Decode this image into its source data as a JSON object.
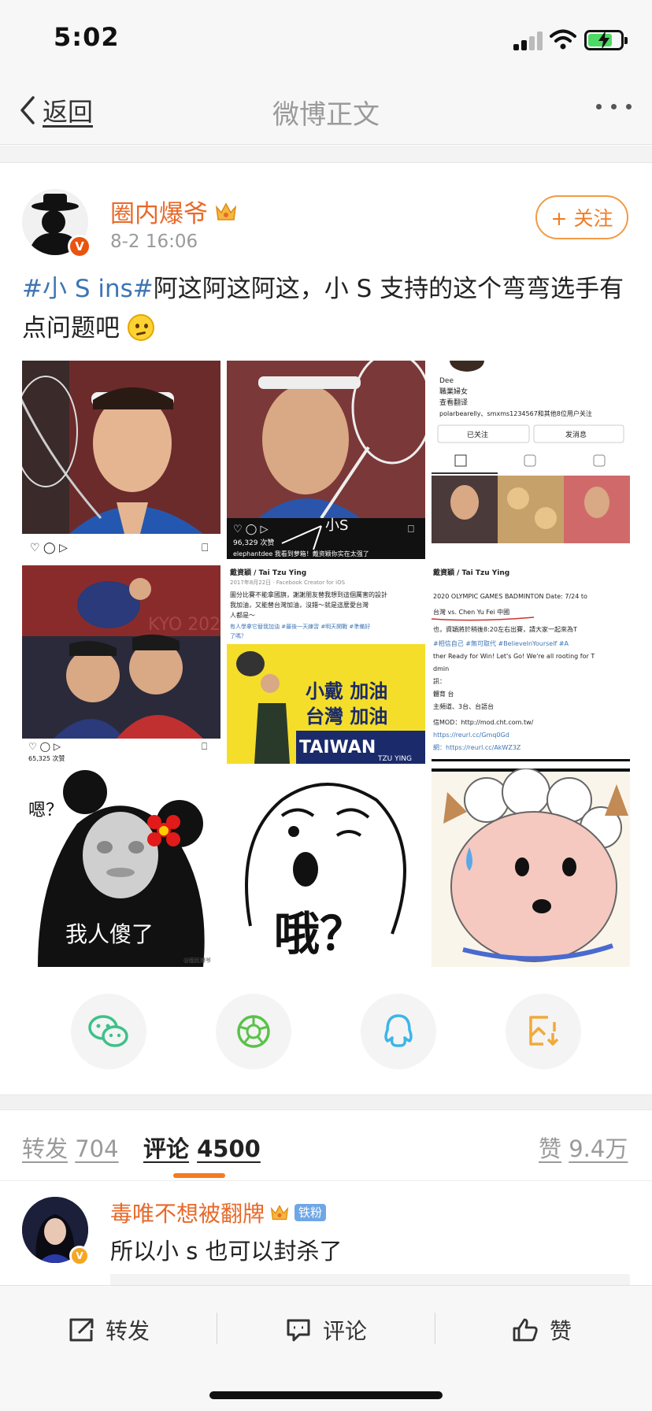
{
  "status_bar": {
    "time": "5:02"
  },
  "nav": {
    "back_label": "返回",
    "title": "微博正文"
  },
  "post": {
    "author": "圈内爆爷",
    "time": "8-2 16:06",
    "follow_label": "+ 关注",
    "hashtag": "#小 S ins#",
    "text": "阿这阿这阿这，小 S 支持的这个弯弯选手有点问题吧",
    "images": [
      {
        "caption": ""
      },
      {
        "caption": "96,329 次赞",
        "sub": "elephantdee 我看到萝箱！戴资颖你实在太强了",
        "annotation": "小S"
      },
      {
        "caption": "Dee",
        "sub1": "職業婦女",
        "sub2": "查看翻译",
        "sub3": "polarbearelly、smxms1234567和其他8位用户关注",
        "btn1": "已关注",
        "btn2": "发消息"
      },
      {
        "caption": "65,325 次赞"
      },
      {
        "caption": "戴資穎 / Tai Tzu Ying",
        "sub": "2017年8月22日 · Facebook Creator for iOS",
        "line1": "圖分比賽不能拿國旗，謝謝朋友替我想到這個厲害的設計",
        "line2": "我加油，又能替台灣加油，沒錯～就是這麼愛台灣",
        "line3": "人都是～",
        "line4": "有人學拿它替我加油 #最後一天練習 #明天開戰 #準備好",
        "line5": "了嗎？",
        "banner1": "小戴 加油",
        "banner2": "台灣 加油",
        "banner3": "TAIWAN",
        "banner4": "TZU YING"
      },
      {
        "caption": "戴資穎 / Tai Tzu Ying",
        "line1": "2020 OLYMPIC GAMES BADMINTON Date: 7/24 to",
        "line2": "台灣 vs. Chen Yu Fei 中國",
        "line3": "也，資穎將於稍後8:20左右出賽，請大家一起來為T",
        "line4": "#相信自己 #無可取代 #BelieveInYourself #A",
        "line5": "ther Ready for Win! Let's Go! We're all rooting for T",
        "line6": "dmin",
        "line7": "訊：",
        "line8": "體育 台",
        "line9": "主頻道、3台、台語台",
        "line10": "信MOD：http://mod.cht.com.tw/",
        "line11": "https://reurl.cc/Gmq0Gd",
        "line12": "網：https://reurl.cc/AkWZ3Z"
      },
      {
        "caption": "嗯？",
        "sub": "我人傻了",
        "watermark": "@國民爆爷"
      },
      {
        "caption": "哦？"
      },
      {
        "caption": ""
      }
    ]
  },
  "share": {
    "icons": [
      "wechat-icon",
      "moments-icon",
      "qq-icon",
      "save-image-icon"
    ]
  },
  "tabs": {
    "repost_label": "转发",
    "repost_count": "704",
    "comment_label": "评论",
    "comment_count": "4500",
    "like_label": "赞",
    "like_count": "9.4万"
  },
  "comment": {
    "author": "毒唯不想被翻牌",
    "badge": "铁粉",
    "text": "所以小 s 也可以封杀了"
  },
  "actions": {
    "repost": "转发",
    "comment": "评论",
    "like": "赞"
  },
  "colors": {
    "accent_orange": "#e8692a",
    "hashtag_blue": "#3d75b5",
    "tab_indicator": "#f47b20"
  }
}
